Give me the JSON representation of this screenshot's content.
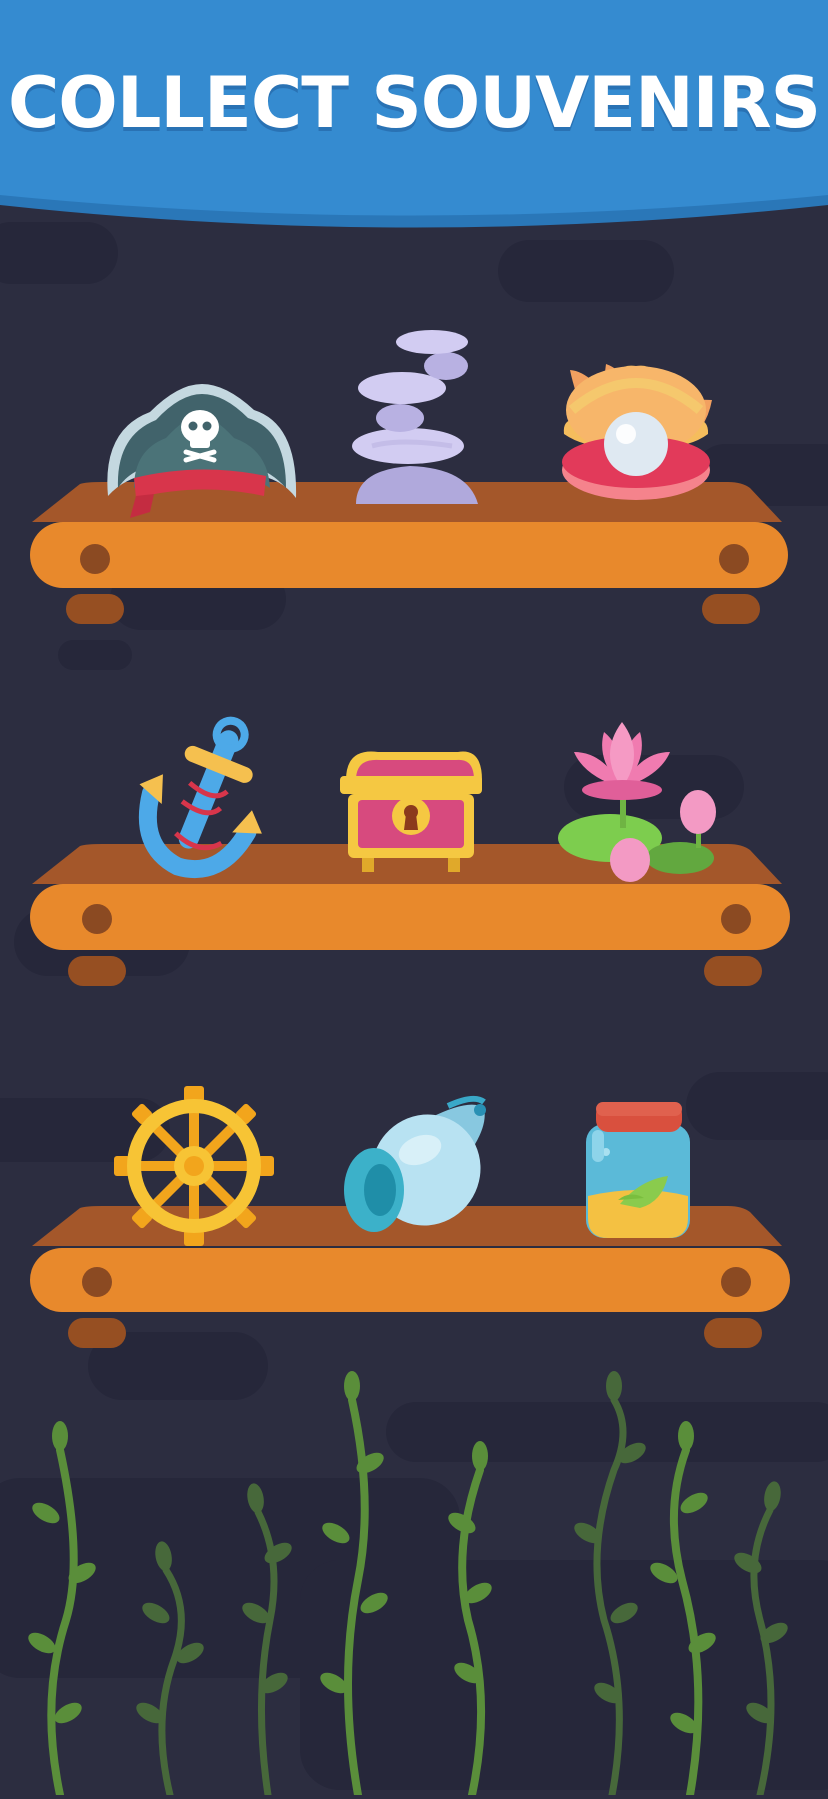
{
  "banner": {
    "title": "COLLECT SOUVENIRS",
    "color": "#358bd0"
  },
  "shelves": [
    {
      "items": [
        "pirate-hat",
        "stacked-stones",
        "pearl-oyster"
      ]
    },
    {
      "items": [
        "anchor",
        "treasure-chest",
        "lotus-lily-pad"
      ]
    },
    {
      "items": [
        "ship-wheel",
        "seashell",
        "message-jar"
      ]
    }
  ],
  "colors": {
    "background": "#2c2d40",
    "shelf_front": "#e8892c",
    "shelf_top": "#a4572a",
    "shelf_leg": "#964f22",
    "seaweed_light": "#5a8e3a",
    "seaweed_dark": "#47683a"
  }
}
